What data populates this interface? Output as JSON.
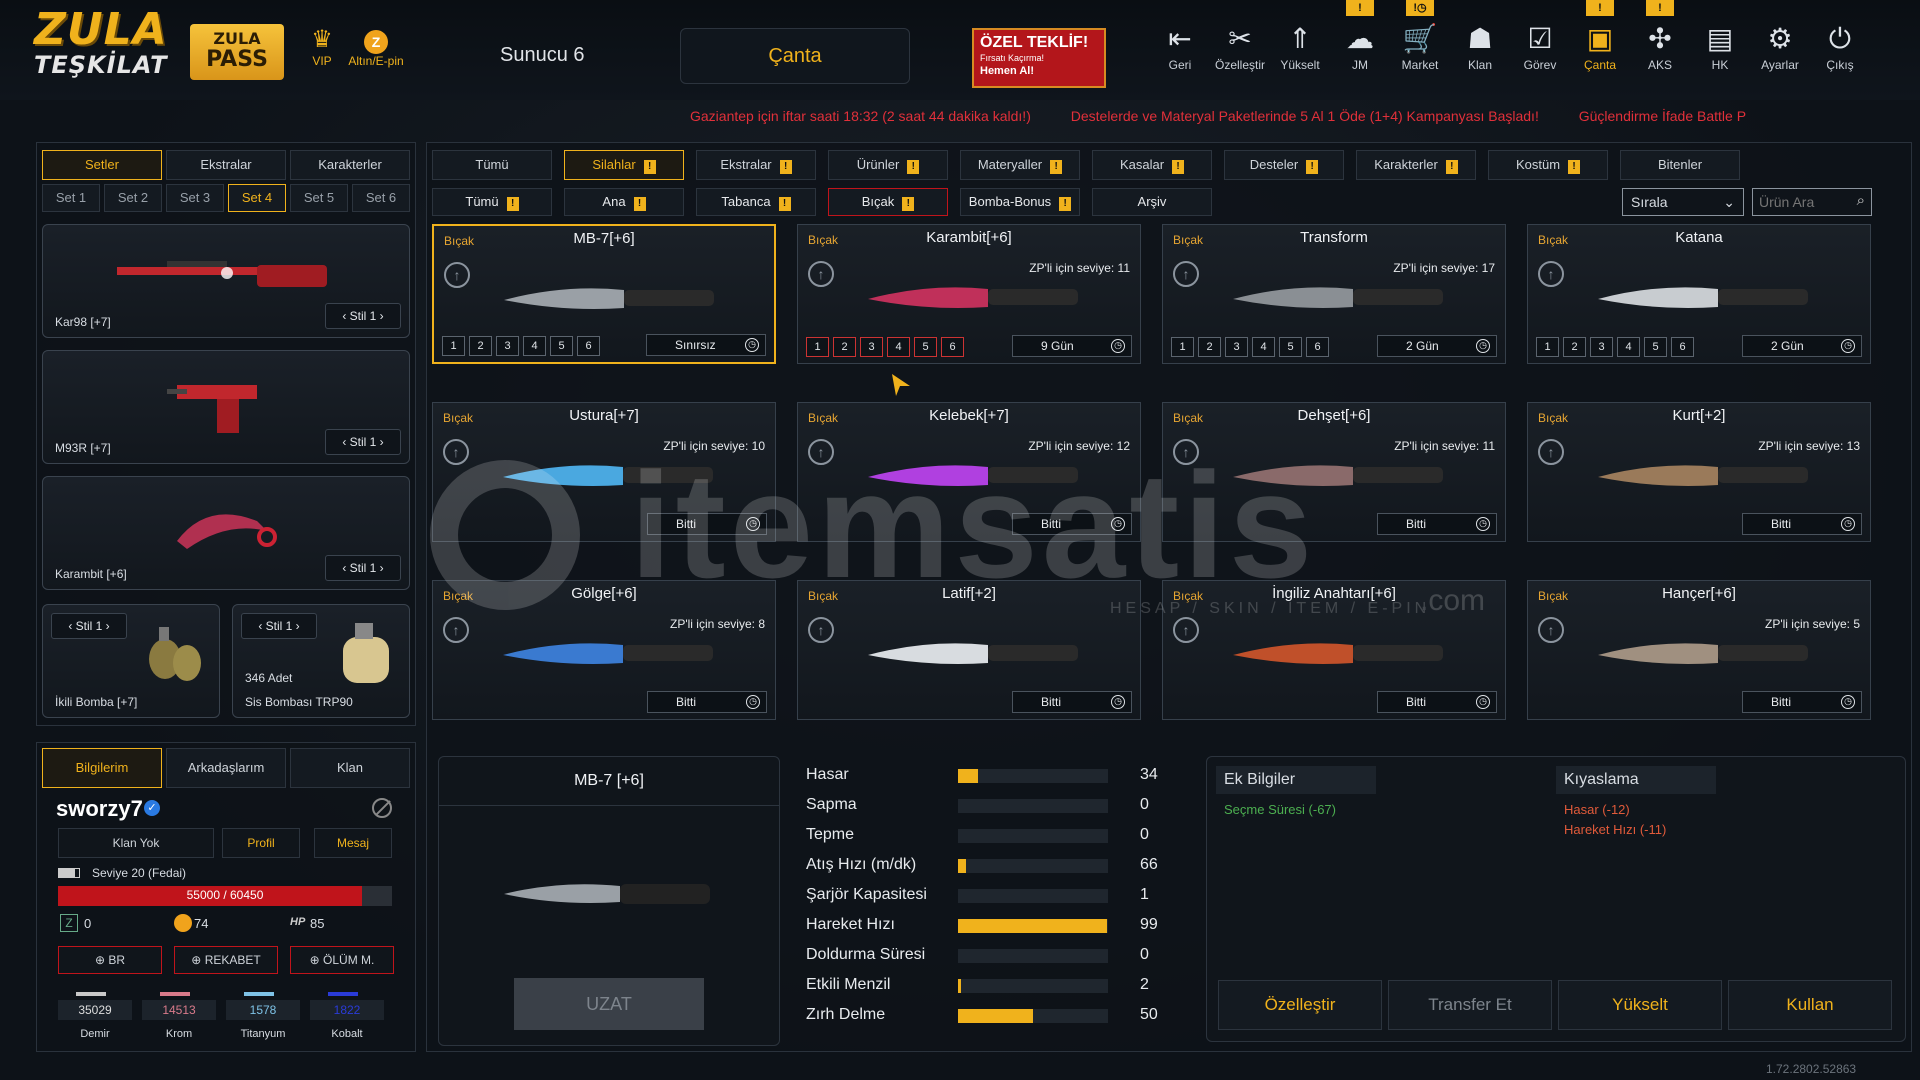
{
  "header": {
    "logo_line1": "ZULA",
    "logo_line2": "TEŞKİLAT",
    "pass_line1": "ZULA",
    "pass_line2": "PASS",
    "vip_label": "VIP",
    "altin_label": "Altın/E-pin",
    "server": "Sunucu 6",
    "canta_label": "Çanta",
    "offer_title": "ÖZEL TEKLİF!",
    "offer_sub": "Fırsatı Kaçırma!",
    "offer_cta": "Hemen Al!",
    "nav": [
      {
        "label": "Geri",
        "icon": "back-icon"
      },
      {
        "label": "Özelleştir",
        "icon": "tools-icon"
      },
      {
        "label": "Yükselt",
        "icon": "upgrade-icon"
      },
      {
        "label": "JM",
        "icon": "jm-icon",
        "badge": "!"
      },
      {
        "label": "Market",
        "icon": "cart-icon",
        "badge": "!◷"
      },
      {
        "label": "Klan",
        "icon": "clan-icon"
      },
      {
        "label": "Görev",
        "icon": "task-icon"
      },
      {
        "label": "Çanta",
        "icon": "bag-icon",
        "badge": "!"
      },
      {
        "label": "AKS",
        "icon": "aks-icon",
        "badge": "!"
      },
      {
        "label": "HK",
        "icon": "wallet-icon"
      },
      {
        "label": "Ayarlar",
        "icon": "gear-icon"
      },
      {
        "label": "Çıkış",
        "icon": "power-icon"
      }
    ]
  },
  "ticker": [
    "Gaziantep için iftar saati 18:32 (2 saat 44 dakika kaldı!)",
    "Destelerde ve Materyal Paketlerinde 5 Al 1 Öde (1+4) Kampanyası Başladı!",
    "Güçlendirme İfade Battle P"
  ],
  "left": {
    "tabs": [
      "Setler",
      "Ekstralar",
      "Karakterler"
    ],
    "set_tabs": [
      "Set 1",
      "Set 2",
      "Set 3",
      "Set 4",
      "Set 5",
      "Set 6"
    ],
    "stil": "Stil 1",
    "set_items": [
      "Kar98 [+7]",
      "M93R [+7]",
      "Karambit [+6]"
    ],
    "bomb1": "İkili Bomba [+7]",
    "bomb2_count": "346 Adet",
    "bomb2": "Sis Bombası TRP90"
  },
  "profile": {
    "tabs": [
      "Bilgilerim",
      "Arkadaşlarım",
      "Klan"
    ],
    "name": "sworzy7",
    "clan": "Klan Yok",
    "profil": "Profil",
    "mesaj": "Mesaj",
    "level": "Seviye 20 (Fedai)",
    "xp_text": "55000 / 60450",
    "xp_fraction": 0.91,
    "zp": "0",
    "gold": "74",
    "hp": "85",
    "modes": [
      "BR",
      "REKABET",
      "ÖLÜM M."
    ],
    "materials": [
      {
        "value": "35029",
        "label": "Demir",
        "color": "#c8c8c8"
      },
      {
        "value": "14513",
        "label": "Krom",
        "color": "#d87a8a"
      },
      {
        "value": "1578",
        "label": "Titanyum",
        "color": "#7ec2e6"
      },
      {
        "value": "1822",
        "label": "Kobalt",
        "color": "#2a3bd8"
      }
    ]
  },
  "filters": {
    "top": [
      "Tümü",
      "Silahlar",
      "Ekstralar",
      "Ürünler",
      "Materyaller",
      "Kasalar",
      "Desteler",
      "Karakterler",
      "Kostüm",
      "Bitenler"
    ],
    "sub": [
      "Tümü",
      "Ana",
      "Tabanca",
      "Bıçak",
      "Bomba-Bonus",
      "Arşiv"
    ],
    "sort": "Sırala",
    "search_placeholder": "Ürün Ara"
  },
  "items": [
    {
      "cat": "Bıçak",
      "name": "MB-7[+6]",
      "zp": "",
      "dur": "Sınırsız",
      "nums": true
    },
    {
      "cat": "Bıçak",
      "name": "Karambit[+6]",
      "zp": "ZP'li için seviye: 11",
      "dur": "9 Gün",
      "nums": true
    },
    {
      "cat": "Bıçak",
      "name": "Transform",
      "zp": "ZP'li için seviye: 17",
      "dur": "2 Gün",
      "nums": true
    },
    {
      "cat": "Bıçak",
      "name": "Katana",
      "zp": "",
      "dur": "2 Gün",
      "nums": true
    },
    {
      "cat": "Bıçak",
      "name": "Ustura[+7]",
      "zp": "ZP'li için seviye: 10",
      "dur": "Bitti",
      "nums": false
    },
    {
      "cat": "Bıçak",
      "name": "Kelebek[+7]",
      "zp": "ZP'li için seviye: 12",
      "dur": "Bitti",
      "nums": false
    },
    {
      "cat": "Bıçak",
      "name": "Dehşet[+6]",
      "zp": "ZP'li için seviye: 11",
      "dur": "Bitti",
      "nums": false
    },
    {
      "cat": "Bıçak",
      "name": "Kurt[+2]",
      "zp": "ZP'li için seviye: 13",
      "dur": "Bitti",
      "nums": false
    },
    {
      "cat": "Bıçak",
      "name": "Gölge[+6]",
      "zp": "ZP'li için seviye: 8",
      "dur": "Bitti",
      "nums": false
    },
    {
      "cat": "Bıçak",
      "name": "Latif[+2]",
      "zp": "",
      "dur": "Bitti",
      "nums": false
    },
    {
      "cat": "Bıçak",
      "name": "İngiliz Anahtarı[+6]",
      "zp": "",
      "dur": "Bitti",
      "nums": false
    },
    {
      "cat": "Bıçak",
      "name": "Hançer[+6]",
      "zp": "ZP'li için seviye: 5",
      "dur": "Bitti",
      "nums": false
    }
  ],
  "detail": {
    "name": "MB-7 [+6]",
    "uzat": "UZAT",
    "stats": [
      {
        "label": "Hasar",
        "value": "34",
        "level": 0.13
      },
      {
        "label": "Sapma",
        "value": "0",
        "level": 0
      },
      {
        "label": "Tepme",
        "value": "0",
        "level": 0
      },
      {
        "label": "Atış Hızı (m/dk)",
        "value": "66",
        "level": 0.05
      },
      {
        "label": "Şarjör Kapasitesi",
        "value": "1",
        "level": 0
      },
      {
        "label": "Hareket Hızı",
        "value": "99",
        "level": 0.99
      },
      {
        "label": "Doldurma Süresi",
        "value": "0",
        "level": 0
      },
      {
        "label": "Etkili Menzil",
        "value": "2",
        "level": 0.02
      },
      {
        "label": "Zırh Delme",
        "value": "50",
        "level": 0.5
      }
    ],
    "ek_title": "Ek Bilgiler",
    "ek_items": [
      "Seçme Süresi (-67)"
    ],
    "kiyas_title": "Kıyaslama",
    "kiyas_items": [
      "Hasar (-12)",
      "Hareket Hızı (-11)"
    ],
    "actions": [
      "Özelleştir",
      "Transfer Et",
      "Yükselt",
      "Kullan"
    ]
  },
  "version": "1.72.2802.52863",
  "watermark": {
    "main": "itemsatis",
    "sub": "HESAP / SKIN / ITEM / E-PIN",
    "com": ".com"
  }
}
